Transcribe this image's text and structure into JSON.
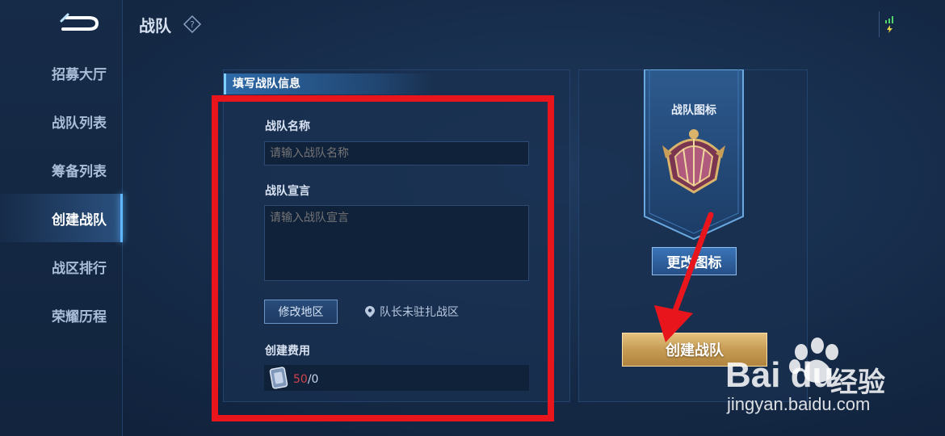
{
  "header": {
    "title": "战队"
  },
  "sidebar": {
    "items": [
      {
        "label": "招募大厅"
      },
      {
        "label": "战队列表"
      },
      {
        "label": "筹备列表"
      },
      {
        "label": "创建战队"
      },
      {
        "label": "战区排行"
      },
      {
        "label": "荣耀历程"
      }
    ],
    "active_index": 3
  },
  "form": {
    "section_title": "填写战队信息",
    "name_label": "战队名称",
    "name_placeholder": "请输入战队名称",
    "name_value": "",
    "declaration_label": "战队宣言",
    "declaration_placeholder": "请输入战队宣言",
    "declaration_value": "",
    "modify_region_label": "修改地区",
    "region_status": "队长未驻扎战区",
    "cost_label": "创建费用",
    "cost_spent": "50",
    "cost_total": "/0"
  },
  "icon_panel": {
    "title": "战队图标",
    "change_button": "更改图标"
  },
  "create_button": "创建战队",
  "watermark": {
    "brand": "Bai du",
    "suffix": "经验",
    "url": "jingyan.baidu.com"
  },
  "colors": {
    "accent_blue": "#5fb8ff",
    "highlight_red": "#e8161c",
    "gold_button": "#c69b53",
    "cost_red": "#d0434b"
  }
}
